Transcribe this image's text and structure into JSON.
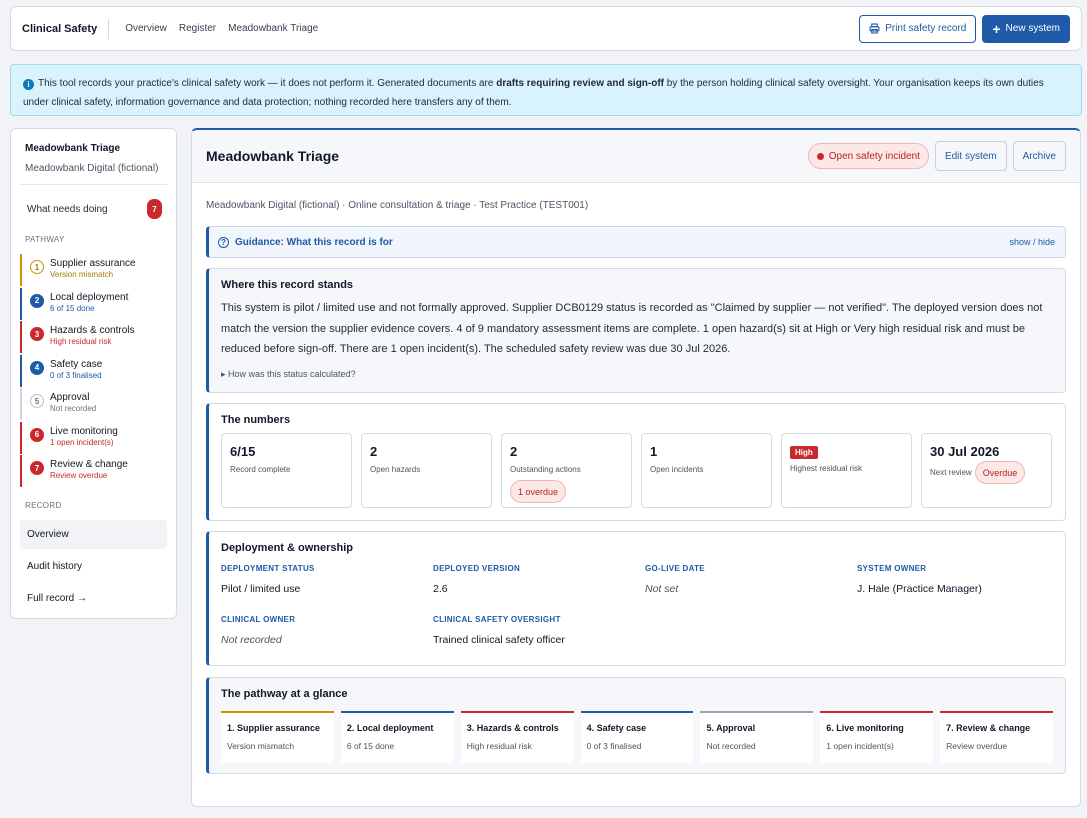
{
  "header": {
    "brand": "Clinical Safety",
    "nav": [
      "Overview",
      "Register",
      "Meadowbank Triage"
    ],
    "print_label": "Print safety record",
    "new_label": "New system"
  },
  "notice": {
    "text_before": "This tool records your practice's clinical safety work — it does not perform it. Generated documents are ",
    "bold": "drafts requiring review and sign-off",
    "text_after": " by the person holding clinical safety oversight. Your organisation keeps its own duties under clinical safety, information governance and data protection; nothing recorded here transfers any of them."
  },
  "sidebar": {
    "title": "Meadowbank Triage",
    "subtitle": "Meadowbank Digital (fictional)",
    "needs_label": "What needs doing",
    "needs_count": "7",
    "pathway_heading": "PATHWAY",
    "steps": [
      {
        "num": "1",
        "label": "Supplier assurance",
        "status": "Version mismatch"
      },
      {
        "num": "2",
        "label": "Local deployment",
        "status": "6 of 15 done"
      },
      {
        "num": "3",
        "label": "Hazards & controls",
        "status": "High residual risk"
      },
      {
        "num": "4",
        "label": "Safety case",
        "status": "0 of 3 finalised"
      },
      {
        "num": "5",
        "label": "Approval",
        "status": "Not recorded"
      },
      {
        "num": "6",
        "label": "Live monitoring",
        "status": "1 open incident(s)"
      },
      {
        "num": "7",
        "label": "Review & change",
        "status": "Review overdue"
      }
    ],
    "record_heading": "RECORD",
    "links": [
      "Overview",
      "Audit history",
      "Full record →"
    ]
  },
  "main": {
    "title": "Meadowbank Triage",
    "incident_label": "Open safety incident",
    "edit_label": "Edit system",
    "archive_label": "Archive",
    "meta": "Meadowbank Digital (fictional) · Online consultation & triage · Test Practice (TEST001)",
    "guidance_title": "Guidance: What this record is for",
    "guidance_toggle": "show / hide",
    "status_heading": "Where this record stands",
    "status_text": "This system is pilot / limited use and not formally approved. Supplier DCB0129 status is recorded as \"Claimed by supplier — not verified\". The deployed version does not match the version the supplier evidence covers. 4 of 9 mandatory assessment items are complete. 1 open hazard(s) sit at High or Very high residual risk and must be reduced before sign-off. There are 1 open incident(s). The scheduled safety review was due 30 Jul 2026.",
    "status_more": "▸ How was this status calculated?",
    "numbers_heading": "The numbers",
    "numbers": [
      {
        "value": "6/15",
        "label": "Record complete"
      },
      {
        "value": "2",
        "label": "Open hazards"
      },
      {
        "value": "2",
        "label": "Outstanding actions",
        "pill": "1 overdue"
      },
      {
        "value": "1",
        "label": "Open incidents"
      },
      {
        "tag": "High",
        "label": "Highest residual risk"
      },
      {
        "value": "30 Jul 2026",
        "label": "Next review",
        "pill": "Overdue"
      }
    ],
    "deploy_heading": "Deployment & ownership",
    "fields": [
      {
        "label": "DEPLOYMENT STATUS",
        "value": "Pilot / limited use",
        "muted": false
      },
      {
        "label": "DEPLOYED VERSION",
        "value": "2.6",
        "muted": false
      },
      {
        "label": "GO-LIVE DATE",
        "value": "Not set",
        "muted": true
      },
      {
        "label": "SYSTEM OWNER",
        "value": "J. Hale (Practice Manager)",
        "muted": false
      },
      {
        "label": "CLINICAL OWNER",
        "value": "Not recorded",
        "muted": true
      },
      {
        "label": "CLINICAL SAFETY OVERSIGHT",
        "value": "Trained clinical safety officer",
        "muted": false
      }
    ],
    "pathway_heading": "The pathway at a glance",
    "pathway": [
      {
        "title": "1. Supplier assurance",
        "status": "Version mismatch"
      },
      {
        "title": "2. Local deployment",
        "status": "6 of 15 done"
      },
      {
        "title": "3. Hazards & controls",
        "status": "High residual risk"
      },
      {
        "title": "4. Safety case",
        "status": "0 of 3 finalised"
      },
      {
        "title": "5. Approval",
        "status": "Not recorded"
      },
      {
        "title": "6. Live monitoring",
        "status": "1 open incident(s)"
      },
      {
        "title": "7. Review & change",
        "status": "Review overdue"
      }
    ]
  },
  "colors": {
    "accent": "#1e5aa8",
    "danger": "#c8282e",
    "warning": "#c99400",
    "info_bg": "#d8f3fb"
  },
  "icons": [
    "info-icon",
    "printer-icon",
    "plus-icon",
    "incident-dot-icon",
    "help-circle-icon"
  ]
}
